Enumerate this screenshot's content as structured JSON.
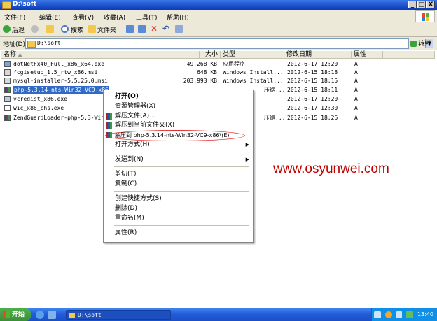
{
  "window": {
    "title": "D:\\soft",
    "min": "_",
    "max": "□",
    "close": "X"
  },
  "menu": [
    "文件(F)",
    "编辑(E)",
    "查看(V)",
    "收藏(A)",
    "工具(T)",
    "帮助(H)"
  ],
  "toolbar": {
    "back": "后退",
    "search": "搜索",
    "folders": "文件夹"
  },
  "address": {
    "label": "地址(D)",
    "value": "D:\\soft",
    "go": "转到"
  },
  "columns": {
    "name": "名称",
    "size": "大小",
    "type": "类型",
    "date": "修改日期",
    "attr": "属性"
  },
  "files": [
    {
      "name": "dotNetFx40_Full_x86_x64.exe",
      "size": "49,268 KB",
      "type": "应用程序",
      "date": "2012-6-17 12:20",
      "attr": "A"
    },
    {
      "name": "fcgisetup_1.5_rtw_x86.msi",
      "size": "648 KB",
      "type": "Windows Install...",
      "date": "2012-6-15 18:18",
      "attr": "A"
    },
    {
      "name": "mysql-installer-5.5.25.0.msi",
      "size": "203,993 KB",
      "type": "Windows Install...",
      "date": "2012-6-15 18:15",
      "attr": "A"
    },
    {
      "name": "php-5.3.14-nts-Win32-VC9-x86",
      "size": "",
      "type": "压缩...",
      "date": "2012-6-15 18:11",
      "attr": "A"
    },
    {
      "name": "vcredist_x86.exe",
      "size": "",
      "type": "",
      "date": "2012-6-17 12:20",
      "attr": "A"
    },
    {
      "name": "wic_x86_chs.exe",
      "size": "",
      "type": "",
      "date": "2012-6-17 12:30",
      "attr": "A"
    },
    {
      "name": "ZendGuardLoader-php-5.3-Win",
      "size": "",
      "type": "压缩...",
      "date": "2012-6-15 18:26",
      "attr": "A"
    }
  ],
  "context_menu": [
    "打开(O)",
    "资源管理器(X)",
    "解压文件(A)...",
    "解压到当前文件夹(X)",
    "解压到 php-5.3.14-nts-Win32-VC9-x86\\(E)",
    "打开方式(H)",
    "发送到(N)",
    "剪切(T)",
    "复制(C)",
    "创建快捷方式(S)",
    "删除(D)",
    "重命名(M)",
    "属性(R)"
  ],
  "watermark": "www.osyunwei.com",
  "taskbar": {
    "start": "开始",
    "task": "D:\\soft",
    "time": "13:40"
  }
}
